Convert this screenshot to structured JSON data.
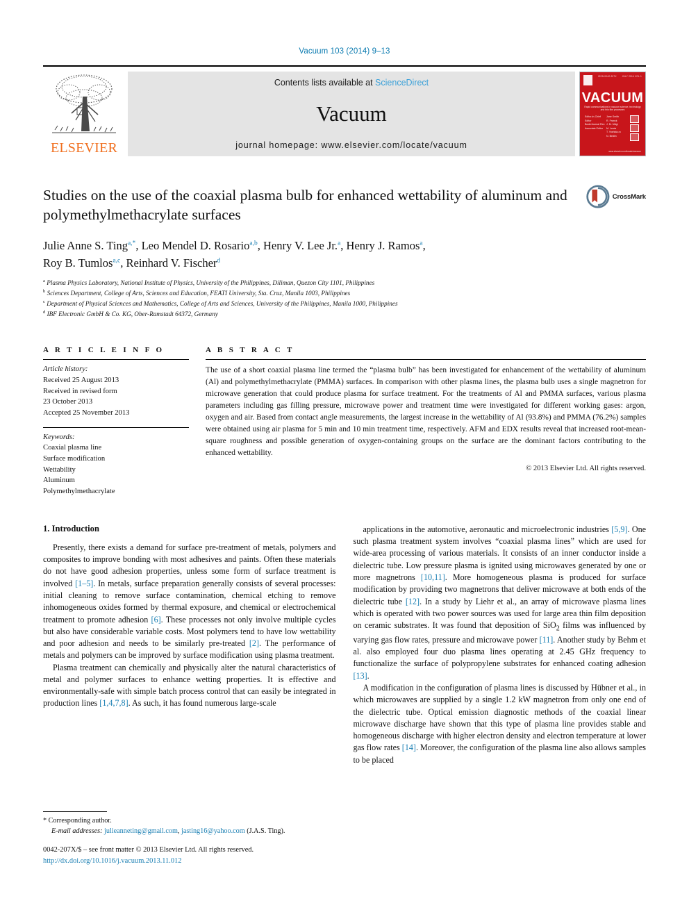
{
  "running_head": "Vacuum 103 (2014) 9–13",
  "header": {
    "publisher": "ELSEVIER",
    "contents_prefix": "Contents lists available at ",
    "sciencedirect": "ScienceDirect",
    "journal_name": "Vacuum",
    "homepage": "journal homepage: www.elsevier.com/locate/vacuum",
    "cover": {
      "title": "VACUUM",
      "subtitle": "Rapid communications in vacuum science, technology and thin film processes",
      "top_left": "ELSEVIER",
      "top_mid": "ISSN 0042-207X",
      "top_mid2": "VOL 103",
      "top_right": "JULY 2014 VOL 1",
      "editors_col1": "Editor-in-Chief\nEditor\nBook/Journal Rev.\nAssociate Editor",
      "editors_col2": "Jane Smith\nR. Franck\nJ. M. Mägi\nM. Lewis\nT. Yoshida-ru\nN. Bedlin",
      "bottom_note": "www.elsevier.com/locate/vacuum"
    }
  },
  "article": {
    "crossmark_label": "CrossMark",
    "title": "Studies on the use of the coaxial plasma bulb for enhanced wettability of aluminum and polymethylmethacrylate surfaces",
    "authors_line1_parts": [
      {
        "name": "Julie Anne S. Ting",
        "sup": "a,*"
      },
      {
        "name": "Leo Mendel D. Rosario",
        "sup": "a,b"
      },
      {
        "name": "Henry V. Lee Jr.",
        "sup": "a"
      },
      {
        "name": "Henry J. Ramos",
        "sup": "a"
      }
    ],
    "authors_line2_parts": [
      {
        "name": "Roy B. Tumlos",
        "sup": "a,c"
      },
      {
        "name": "Reinhard V. Fischer",
        "sup": "d"
      }
    ],
    "affiliations": [
      {
        "mark": "a",
        "text": "Plasma Physics Laboratory, National Institute of Physics, University of the Philippines, Diliman, Quezon City 1101, Philippines"
      },
      {
        "mark": "b",
        "text": "Sciences Department, College of Arts, Sciences and Education, FEATI University, Sta. Cruz, Manila 1003, Philippines"
      },
      {
        "mark": "c",
        "text": "Department of Physical Sciences and Mathematics, College of Arts and Sciences, University of the Philippines, Manila 1000, Philippines"
      },
      {
        "mark": "d",
        "text": "IBF Electronic GmbH & Co. KG, Ober-Ramstadt 64372, Germany"
      }
    ]
  },
  "article_info": {
    "heading": "A R T I C L E  I N F O",
    "history_label": "Article history:",
    "history": [
      "Received 25 August 2013",
      "Received in revised form",
      "23 October 2013",
      "Accepted 25 November 2013"
    ],
    "keywords_label": "Keywords:",
    "keywords": [
      "Coaxial plasma line",
      "Surface modification",
      "Wettability",
      "Aluminum",
      "Polymethylmethacrylate"
    ]
  },
  "abstract": {
    "heading": "A B S T R A C T",
    "text": "The use of a short coaxial plasma line termed the “plasma bulb” has been investigated for enhancement of the wettability of aluminum (Al) and polymethylmethacrylate (PMMA) surfaces. In comparison with other plasma lines, the plasma bulb uses a single magnetron for microwave generation that could produce plasma for surface treatment. For the treatments of Al and PMMA surfaces, various plasma parameters including gas filling pressure, microwave power and treatment time were investigated for different working gases: argon, oxygen and air. Based from contact angle measurements, the largest increase in the wettability of Al (93.8%) and PMMA (76.2%) samples were obtained using air plasma for 5 min and 10 min treatment time, respectively. AFM and EDX results reveal that increased root-mean-square roughness and possible generation of oxygen-containing groups on the surface are the dominant factors contributing to the enhanced wettability.",
    "copyright": "© 2013 Elsevier Ltd. All rights reserved."
  },
  "body": {
    "section_title": "1. Introduction",
    "left_paragraphs": [
      "Presently, there exists a demand for surface pre-treatment of metals, polymers and composites to improve bonding with most adhesives and paints. Often these materials do not have good adhesion properties, unless some form of surface treatment is involved [1–5]. In metals, surface preparation generally consists of several processes: initial cleaning to remove surface contamination, chemical etching to remove inhomogeneous oxides formed by thermal exposure, and chemical or electrochemical treatment to promote adhesion [6]. These processes not only involve multiple cycles but also have considerable variable costs. Most polymers tend to have low wettability and poor adhesion and needs to be similarly pre-treated [2]. The performance of metals and polymers can be improved by surface modification using plasma treatment.",
      "Plasma treatment can chemically and physically alter the natural characteristics of metal and polymer surfaces to enhance wetting properties. It is effective and environmentally-safe with simple batch process control that can easily be integrated in production lines [1,4,7,8]. As such, it has found numerous large-scale"
    ],
    "right_paragraphs": [
      "applications in the automotive, aeronautic and microelectronic industries [5,9]. One such plasma treatment system involves “coaxial plasma lines” which are used for wide-area processing of various materials. It consists of an inner conductor inside a dielectric tube. Low pressure plasma is ignited using microwaves generated by one or more magnetrons [10,11]. More homogeneous plasma is produced for surface modification by providing two magnetrons that deliver microwave at both ends of the dielectric tube [12]. In a study by Liehr et al., an array of microwave plasma lines which is operated with two power sources was used for large area thin film deposition on ceramic substrates. It was found that deposition of SiO2 films was influenced by varying gas flow rates, pressure and microwave power [11]. Another study by Behm et al. also employed four duo plasma lines operating at 2.45 GHz frequency to functionalize the surface of polypropylene substrates for enhanced coating adhesion [13].",
      "A modification in the configuration of plasma lines is discussed by Hübner et al., in which microwaves are supplied by a single 1.2 kW magnetron from only one end of the dielectric tube. Optical emission diagnostic methods of the coaxial linear microwave discharge have shown that this type of plasma line provides stable and homogeneous discharge with higher electron density and electron temperature at lower gas flow rates [14]. Moreover, the configuration of the plasma line also allows samples to be placed"
    ]
  },
  "footnotes": {
    "corresponding": "* Corresponding author.",
    "email_label": "E-mail addresses:",
    "email1": "julieanneting@gmail.com",
    "email_sep": ", ",
    "email2": "jasting16@yahoo.com",
    "email_suffix": " (J.A.S. Ting)."
  },
  "footer": {
    "issn_line": "0042-207X/$ – see front matter © 2013 Elsevier Ltd. All rights reserved.",
    "doi": "http://dx.doi.org/10.1016/j.vacuum.2013.11.012"
  },
  "colors": {
    "link": "#1a7fb3",
    "sciencedirect": "#3aa0d8",
    "elsevier_orange": "#f06f1e",
    "cover_red": "#c8151b"
  }
}
